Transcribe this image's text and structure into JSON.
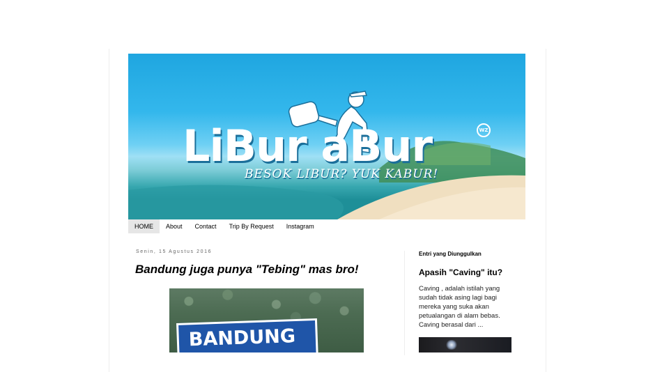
{
  "header": {
    "logo_text": "LiBur  aBur",
    "tagline": "BESOK LIBUR? YUK KABUR!",
    "badge": "WZ"
  },
  "nav": {
    "items": [
      {
        "label": "HOME",
        "active": true
      },
      {
        "label": "About",
        "active": false
      },
      {
        "label": "Contact",
        "active": false
      },
      {
        "label": "Trip By Request",
        "active": false
      },
      {
        "label": "Instagram",
        "active": false
      }
    ]
  },
  "post": {
    "date": "Senin, 15 Agustus 2016",
    "title": "Bandung juga punya \"Tebing\" mas bro!",
    "image_sign_text": "BANDUNG"
  },
  "sidebar": {
    "widget_title": "Entri yang Diunggulkan",
    "popular_title": "Apasih \"Caving\" itu?",
    "popular_snippet": "Caving , adalah istilah yang sudah tidak asing lagi bagi mereka yang suka akan petualangan di alam bebas. Caving berasal dari ..."
  },
  "colors": {
    "sky": "#1fa6e0",
    "sea": "#1e8f98",
    "sand": "#f0dfc0",
    "nav_active_bg": "#e6e6e6",
    "sign_blue": "#1f55a8"
  }
}
